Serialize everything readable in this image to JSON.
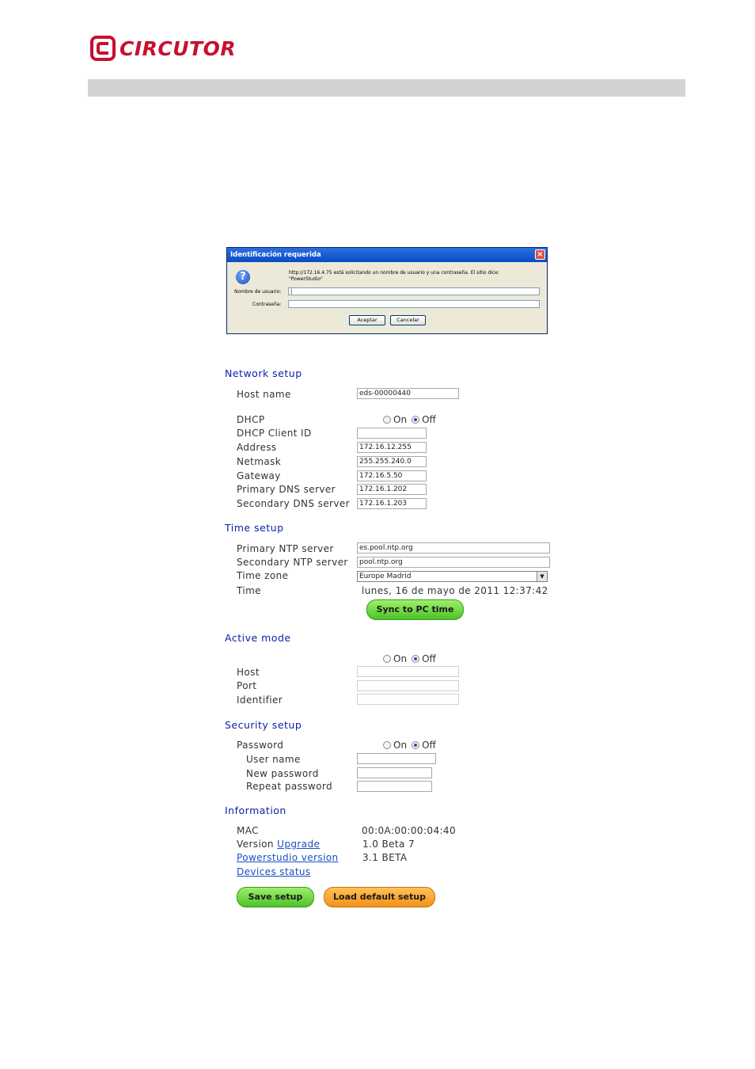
{
  "logo": {
    "text": "CIRCUTOR",
    "color": "#c8102e"
  },
  "dialog": {
    "title": "Identificación requerida",
    "close": "×",
    "message_line1": "http://172.16.4.75 está solicitando un nombre de usuario y una contraseña. El sitio dice:",
    "message_line2": "\"PowerStudio\"",
    "username_label": "Nombre de usuario:",
    "username_value": "|",
    "password_label": "Contraseña:",
    "ok": "Aceptar",
    "cancel": "Cancelar"
  },
  "network": {
    "title": "Network setup",
    "host_name_label": "Host name",
    "host_name_value": "eds-00000440",
    "dhcp_label": "DHCP",
    "dhcp_on": "On",
    "dhcp_off": "Off",
    "dhcp_client_label": "DHCP Client ID",
    "dhcp_client_value": "",
    "address_label": "Address",
    "address_value": "172.16.12.255",
    "netmask_label": "Netmask",
    "netmask_value": "255.255.240.0",
    "gateway_label": "Gateway",
    "gateway_value": "172.16.5.50",
    "dns1_label": "Primary DNS server",
    "dns1_value": "172.16.1.202",
    "dns2_label": "Secondary DNS server",
    "dns2_value": "172.16.1.203"
  },
  "time": {
    "title": "Time setup",
    "ntp1_label": "Primary NTP server",
    "ntp1_value": "es.pool.ntp.org",
    "ntp2_label": "Secondary NTP server",
    "ntp2_value": "pool.ntp.org",
    "tz_label": "Time zone",
    "tz_value": "Europe Madrid",
    "time_label": "Time",
    "time_value": "lunes, 16 de mayo de 2011 12:37:42",
    "sync_button": "Sync to PC time"
  },
  "active": {
    "title": "Active mode",
    "on": "On",
    "off": "Off",
    "host_label": "Host",
    "port_label": "Port",
    "identifier_label": "Identifier"
  },
  "security": {
    "title": "Security setup",
    "password_label": "Password",
    "on": "On",
    "off": "Off",
    "user_label": "User name",
    "newpass_label": "New password",
    "repeat_label": "Repeat password"
  },
  "info": {
    "title": "Information",
    "mac_label": "MAC",
    "mac_value": "00:0A:00:00:04:40",
    "version_label": "Version",
    "upgrade_link": "Upgrade",
    "version_value": "1.0 Beta 7",
    "ps_link": "Powerstudio version",
    "ps_value": "3.1 BETA",
    "devices_link": "Devices status"
  },
  "buttons": {
    "save": "Save setup",
    "load_default": "Load default setup"
  }
}
